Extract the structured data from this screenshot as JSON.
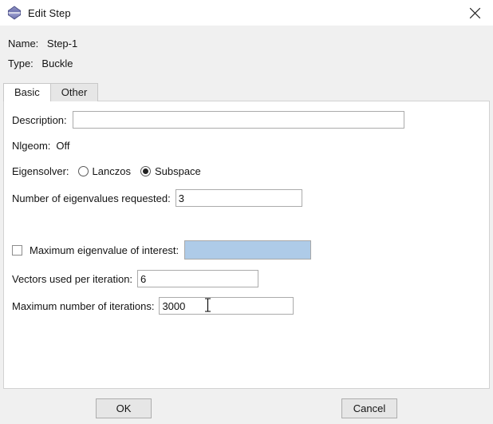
{
  "window": {
    "title": "Edit Step",
    "icon": "step-icon",
    "close_icon": "close-icon"
  },
  "header": {
    "name_label": "Name:",
    "name_value": "Step-1",
    "type_label": "Type:",
    "type_value": "Buckle"
  },
  "tabs": [
    {
      "label": "Basic",
      "active": true
    },
    {
      "label": "Other",
      "active": false
    }
  ],
  "basic": {
    "description_label": "Description:",
    "description_value": "",
    "nlgeom_label": "Nlgeom:",
    "nlgeom_value": "Off",
    "eigensolver_label": "Eigensolver:",
    "eigensolver_options": [
      {
        "label": "Lanczos",
        "selected": false
      },
      {
        "label": "Subspace",
        "selected": true
      }
    ],
    "num_eigenvalues_label": "Number of eigenvalues requested:",
    "num_eigenvalues_value": "3",
    "max_eigenvalue_label": "Maximum eigenvalue of interest:",
    "max_eigenvalue_checked": false,
    "max_eigenvalue_value": "",
    "vectors_label": "Vectors used per iteration:",
    "vectors_value": "6",
    "max_iterations_label": "Maximum number of iterations:",
    "max_iterations_value": "3000"
  },
  "footer": {
    "ok_label": "OK",
    "cancel_label": "Cancel"
  },
  "colors": {
    "highlight_field": "#aecbe8",
    "window_background": "#f0f0f0",
    "panel_background": "#ffffff"
  }
}
